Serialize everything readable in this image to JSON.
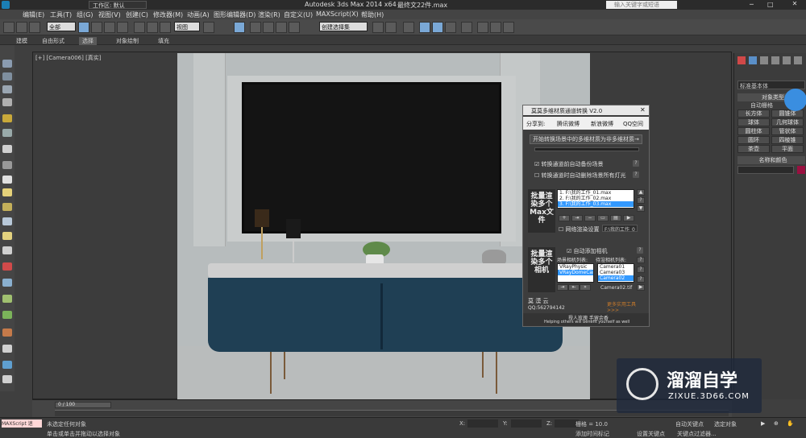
{
  "app": {
    "title": "Autodesk 3ds Max  2014 x64",
    "file": "最终文22件.max",
    "workspace": "工作区: 默认",
    "search_placeholder": "输入关键字或短语"
  },
  "menu": [
    "编辑(E)",
    "工具(T)",
    "组(G)",
    "视图(V)",
    "创建(C)",
    "修改器(M)",
    "动画(A)",
    "图形编辑器(D)",
    "渲染(R)",
    "自定义(U)",
    "MAXScript(X)",
    "帮助(H)"
  ],
  "toolbar": {
    "selection_filter": "全部",
    "view_dropdown": "视图",
    "named_set": "创建选择集"
  },
  "ribbon": {
    "items": [
      "建模",
      "自由形式",
      "选择",
      "对象绘制",
      "填充"
    ],
    "active": "选择"
  },
  "viewport": {
    "label": "[+] [Camera006] [真实]"
  },
  "right_panel": {
    "category": "标准基本体",
    "section_title": "对象类型",
    "auto_grid": "自动栅格",
    "buttons": [
      "长方体",
      "圆锥体",
      "球体",
      "几何球体",
      "圆柱体",
      "管状体",
      "圆环",
      "四棱锥",
      "茶壶",
      "平面"
    ],
    "name_color": "名称和颜色"
  },
  "dialog": {
    "title": "莫莫多维材质通道转换 V2.0",
    "share_label": "分享到:",
    "share_links": [
      "腾讯微博",
      "新浪微博",
      "QQ空间"
    ],
    "convert_button": "开始转换场景中的多维材质为非多维材质→",
    "opt1": "转换通道前自动备份场景",
    "opt2": "转换通道时自动删除场景所有灯光",
    "batch_label1": "批量渲染多个Max文件",
    "files": [
      "1. F:\\我的工作_01.max",
      "2. F:\\我的工作_02.max",
      "3. F:\\我的工作_03.max"
    ],
    "net_render": "网络渲染设置",
    "net_path": "F:\\我的工作_0",
    "batch_label2": "批量渲染多个相机",
    "auto_add_camera": "自动添加相机",
    "scene_cam_label": "场景相机列表:",
    "render_cam_label": "待渲相机列表:",
    "scene_cams": [
      "VRayPhysic",
      "VRayDomeCame"
    ],
    "render_cams": [
      "Camera01",
      "Camera03",
      "Camera02"
    ],
    "output_file": "Camera02.tif",
    "author": "莫 漠 云",
    "qq": "QQ:562794142",
    "more_link": "更多实用工具 >>>",
    "footer_cn": "授人玫瑰  手留余香",
    "footer_en": "Helping others will benefit yourself as well"
  },
  "timeline": {
    "frame": "0 / 100"
  },
  "status": {
    "script_label": "MAXScript 迷",
    "line1": "未选定任何对象",
    "line2": "单击或单击并拖动以选择对象",
    "x_label": "X:",
    "y_label": "Y:",
    "z_label": "Z:",
    "grid": "栅格 = 10.0",
    "add_key": "添加时间标记",
    "set_key": "设置关键点",
    "key_filter": "关键点过滤器...",
    "auto_key": "自动关键点",
    "selected": "选定对象"
  },
  "watermark": {
    "brand": "溜溜自学",
    "url": "ZIXUE.3D66.COM"
  },
  "colors": {
    "accent": "#3399ff",
    "cabinet": "#1f3f54",
    "background": "#3f3f3f"
  }
}
